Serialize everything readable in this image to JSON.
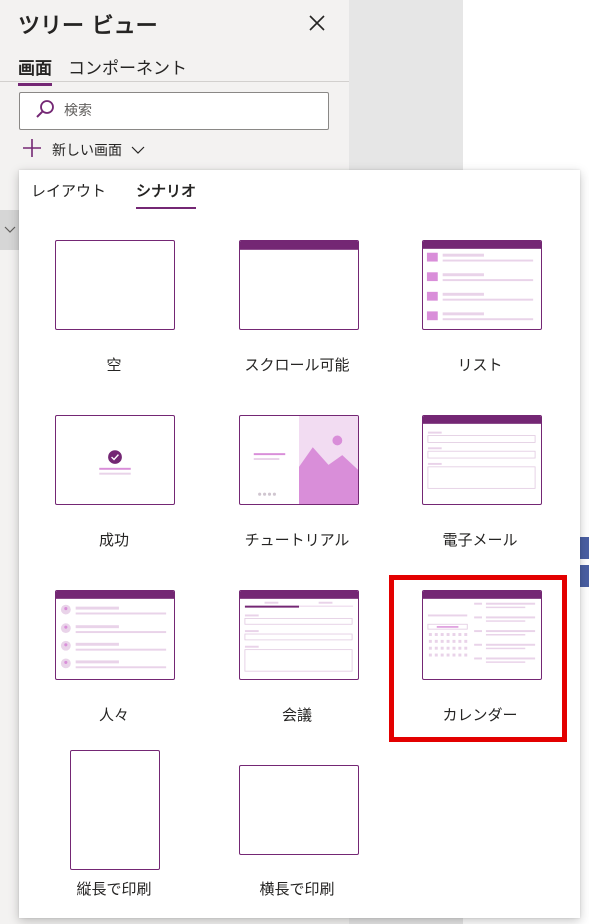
{
  "tree_view": {
    "title": "ツリー ビュー",
    "tabs": [
      {
        "label": "画面",
        "active": true
      },
      {
        "label": "コンポーネント",
        "active": false
      }
    ],
    "search": {
      "placeholder": "検索",
      "value": ""
    },
    "new_screen_label": "新しい画面"
  },
  "new_screen_menu": {
    "tabs": [
      {
        "label": "レイアウト",
        "active": false
      },
      {
        "label": "シナリオ",
        "active": true
      }
    ],
    "templates": [
      {
        "label": "空"
      },
      {
        "label": "スクロール可能"
      },
      {
        "label": "リスト"
      },
      {
        "label": "成功"
      },
      {
        "label": "チュートリアル"
      },
      {
        "label": "電子メール"
      },
      {
        "label": "人々"
      },
      {
        "label": "会議"
      },
      {
        "label": "カレンダー",
        "highlighted": true
      },
      {
        "label": "縦長で印刷"
      },
      {
        "label": "横長で印刷"
      }
    ]
  },
  "colors": {
    "accent": "#742774",
    "thumb_light": "#e9d3e9",
    "illustration": "#d98ed9",
    "highlight_box": "#e30000"
  }
}
